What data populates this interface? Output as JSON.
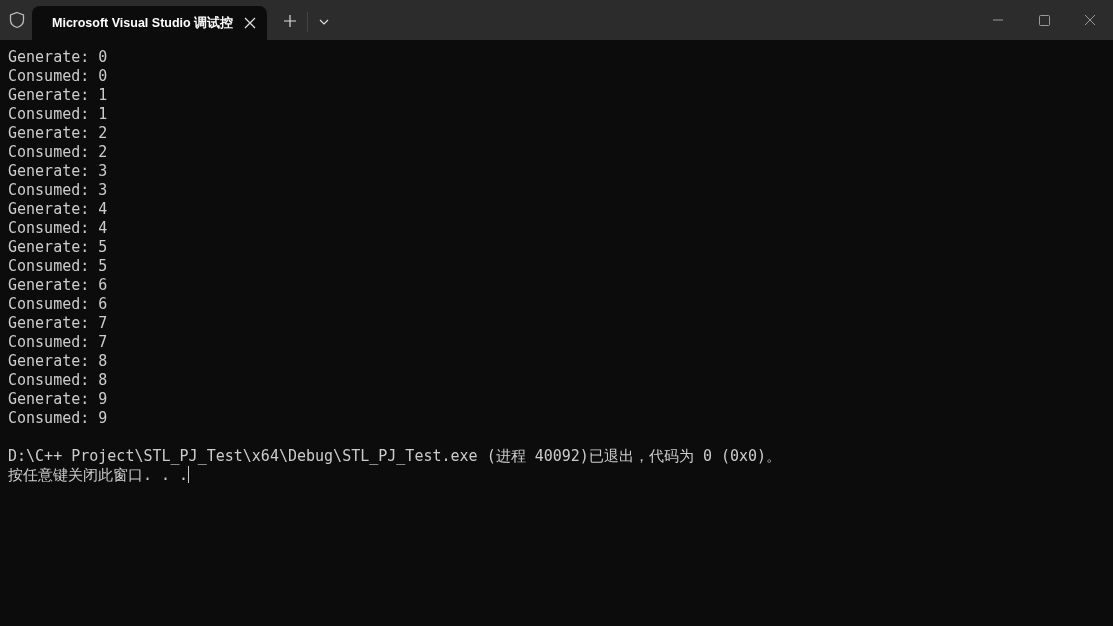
{
  "window": {
    "tab": {
      "title": "Microsoft Visual Studio 调试控",
      "selected": true
    }
  },
  "console": {
    "lines": [
      "Generate: 0",
      "Consumed: 0",
      "Generate: 1",
      "Consumed: 1",
      "Generate: 2",
      "Consumed: 2",
      "Generate: 3",
      "Consumed: 3",
      "Generate: 4",
      "Consumed: 4",
      "Generate: 5",
      "Consumed: 5",
      "Generate: 6",
      "Consumed: 6",
      "Generate: 7",
      "Consumed: 7",
      "Generate: 8",
      "Consumed: 8",
      "Generate: 9",
      "Consumed: 9"
    ],
    "exit_message": "D:\\C++ Project\\STL_PJ_Test\\x64\\Debug\\STL_PJ_Test.exe (进程 40092)已退出，代码为 0 (0x0)。",
    "prompt": "按任意键关闭此窗口. . ."
  }
}
